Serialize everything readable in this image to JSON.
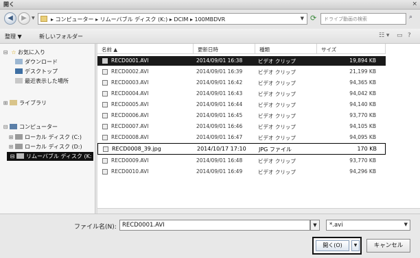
{
  "window": {
    "title": "開く",
    "close_glyph": "×"
  },
  "nav": {
    "back_glyph": "◀",
    "forward_glyph": "▶",
    "address": "▸ コンピューター ▸ リムーバブル ディスク (K:) ▸ DCIM ▸ 100MBDVR",
    "search_placeholder": "ドライブ動画の検索"
  },
  "toolbar": {
    "organize": "整理 ▼",
    "new_folder": "新しいフォルダー"
  },
  "sidebar": {
    "favorites": "お気に入り",
    "downloads": "ダウンロード",
    "desktop": "デスクトップ",
    "recent": "最近表示した場所",
    "libraries": "ライブラリ",
    "computer": "コンピューター",
    "local_c": "ローカル ディスク (C:)",
    "local_d": "ローカル ディスク (D:)",
    "removable": "リムーバブル ディスク (K:"
  },
  "columns": {
    "name": "名前 ▲",
    "date": "更新日時",
    "type": "種類",
    "size": "サイズ"
  },
  "files": [
    {
      "name": "RECD0001.AVI",
      "date": "2014/09/01 16:38",
      "type": "ビデオ クリップ",
      "size": "19,894 KB"
    },
    {
      "name": "RECD0002.AVI",
      "date": "2014/09/01 16:39",
      "type": "ビデオ クリップ",
      "size": "21,199 KB"
    },
    {
      "name": "RECD0003.AVI",
      "date": "2014/09/01 16:42",
      "type": "ビデオ クリップ",
      "size": "94,365 KB"
    },
    {
      "name": "RECD0004.AVI",
      "date": "2014/09/01 16:43",
      "type": "ビデオ クリップ",
      "size": "94,042 KB"
    },
    {
      "name": "RECD0005.AVI",
      "date": "2014/09/01 16:44",
      "type": "ビデオ クリップ",
      "size": "94,140 KB"
    },
    {
      "name": "RECD0006.AVI",
      "date": "2014/09/01 16:45",
      "type": "ビデオ クリップ",
      "size": "93,770 KB"
    },
    {
      "name": "RECD0007.AVI",
      "date": "2014/09/01 16:46",
      "type": "ビデオ クリップ",
      "size": "94,105 KB"
    },
    {
      "name": "RECD0008.AVI",
      "date": "2014/09/01 16:47",
      "type": "ビデオ クリップ",
      "size": "94,095 KB"
    },
    {
      "name": "RECD0008_39.jpg",
      "date": "2014/10/17 17:10",
      "type": "JPG ファイル",
      "size": "170 KB"
    },
    {
      "name": "RECD0009.AVI",
      "date": "2014/09/01 16:48",
      "type": "ビデオ クリップ",
      "size": "93,770 KB"
    },
    {
      "name": "RECD0010.AVI",
      "date": "2014/09/01 16:49",
      "type": "ビデオ クリップ",
      "size": "94,296 KB"
    }
  ],
  "footer": {
    "filename_label": "ファイル名(N):",
    "filename_value": "RECD0001.AVI",
    "filetype_value": "*.avi",
    "open_label": "開く(O)",
    "cancel_label": "キャンセル"
  }
}
